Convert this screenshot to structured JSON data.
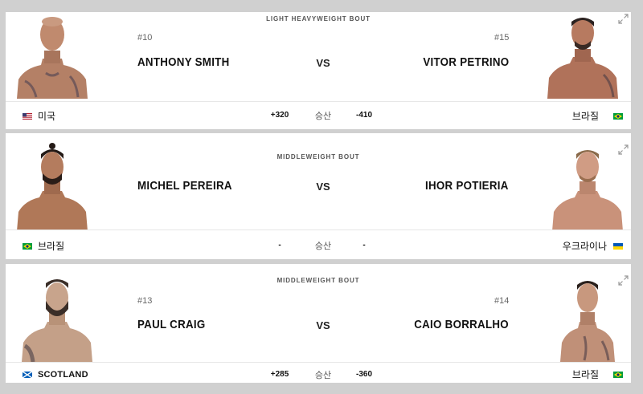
{
  "bouts": [
    {
      "weight_class": "LIGHT HEAVYWEIGHT BOUT",
      "vs": "VS",
      "odds_label": "승산",
      "red": {
        "rank": "#10",
        "name": "ANTHONY SMITH",
        "country": "미국",
        "flag": "usa",
        "odds": "+320"
      },
      "blue": {
        "rank": "#15",
        "name": "VITOR PETRINO",
        "country": "브라질",
        "flag": "brazil",
        "odds": "-410"
      }
    },
    {
      "weight_class": "MIDDLEWEIGHT BOUT",
      "vs": "VS",
      "odds_label": "승산",
      "red": {
        "rank": "",
        "name": "MICHEL PEREIRA",
        "country": "브라질",
        "flag": "brazil",
        "odds": "-"
      },
      "blue": {
        "rank": "",
        "name": "IHOR POTIERIA",
        "country": "우크라이나",
        "flag": "ukraine",
        "odds": "-"
      }
    },
    {
      "weight_class": "MIDDLEWEIGHT BOUT",
      "vs": "VS",
      "odds_label": "승산",
      "red": {
        "rank": "#13",
        "name": "PAUL CRAIG",
        "country": "SCOTLAND",
        "flag": "scotland",
        "odds": "+285"
      },
      "blue": {
        "rank": "#14",
        "name": "CAIO BORRALHO",
        "country": "브라질",
        "flag": "brazil",
        "odds": "-360"
      }
    }
  ],
  "colors": {
    "background": "#d0d0d0",
    "card": "#ffffff",
    "text": "#111111",
    "muted": "#666666"
  },
  "icons": {
    "expand": "expand-arrows-icon"
  }
}
